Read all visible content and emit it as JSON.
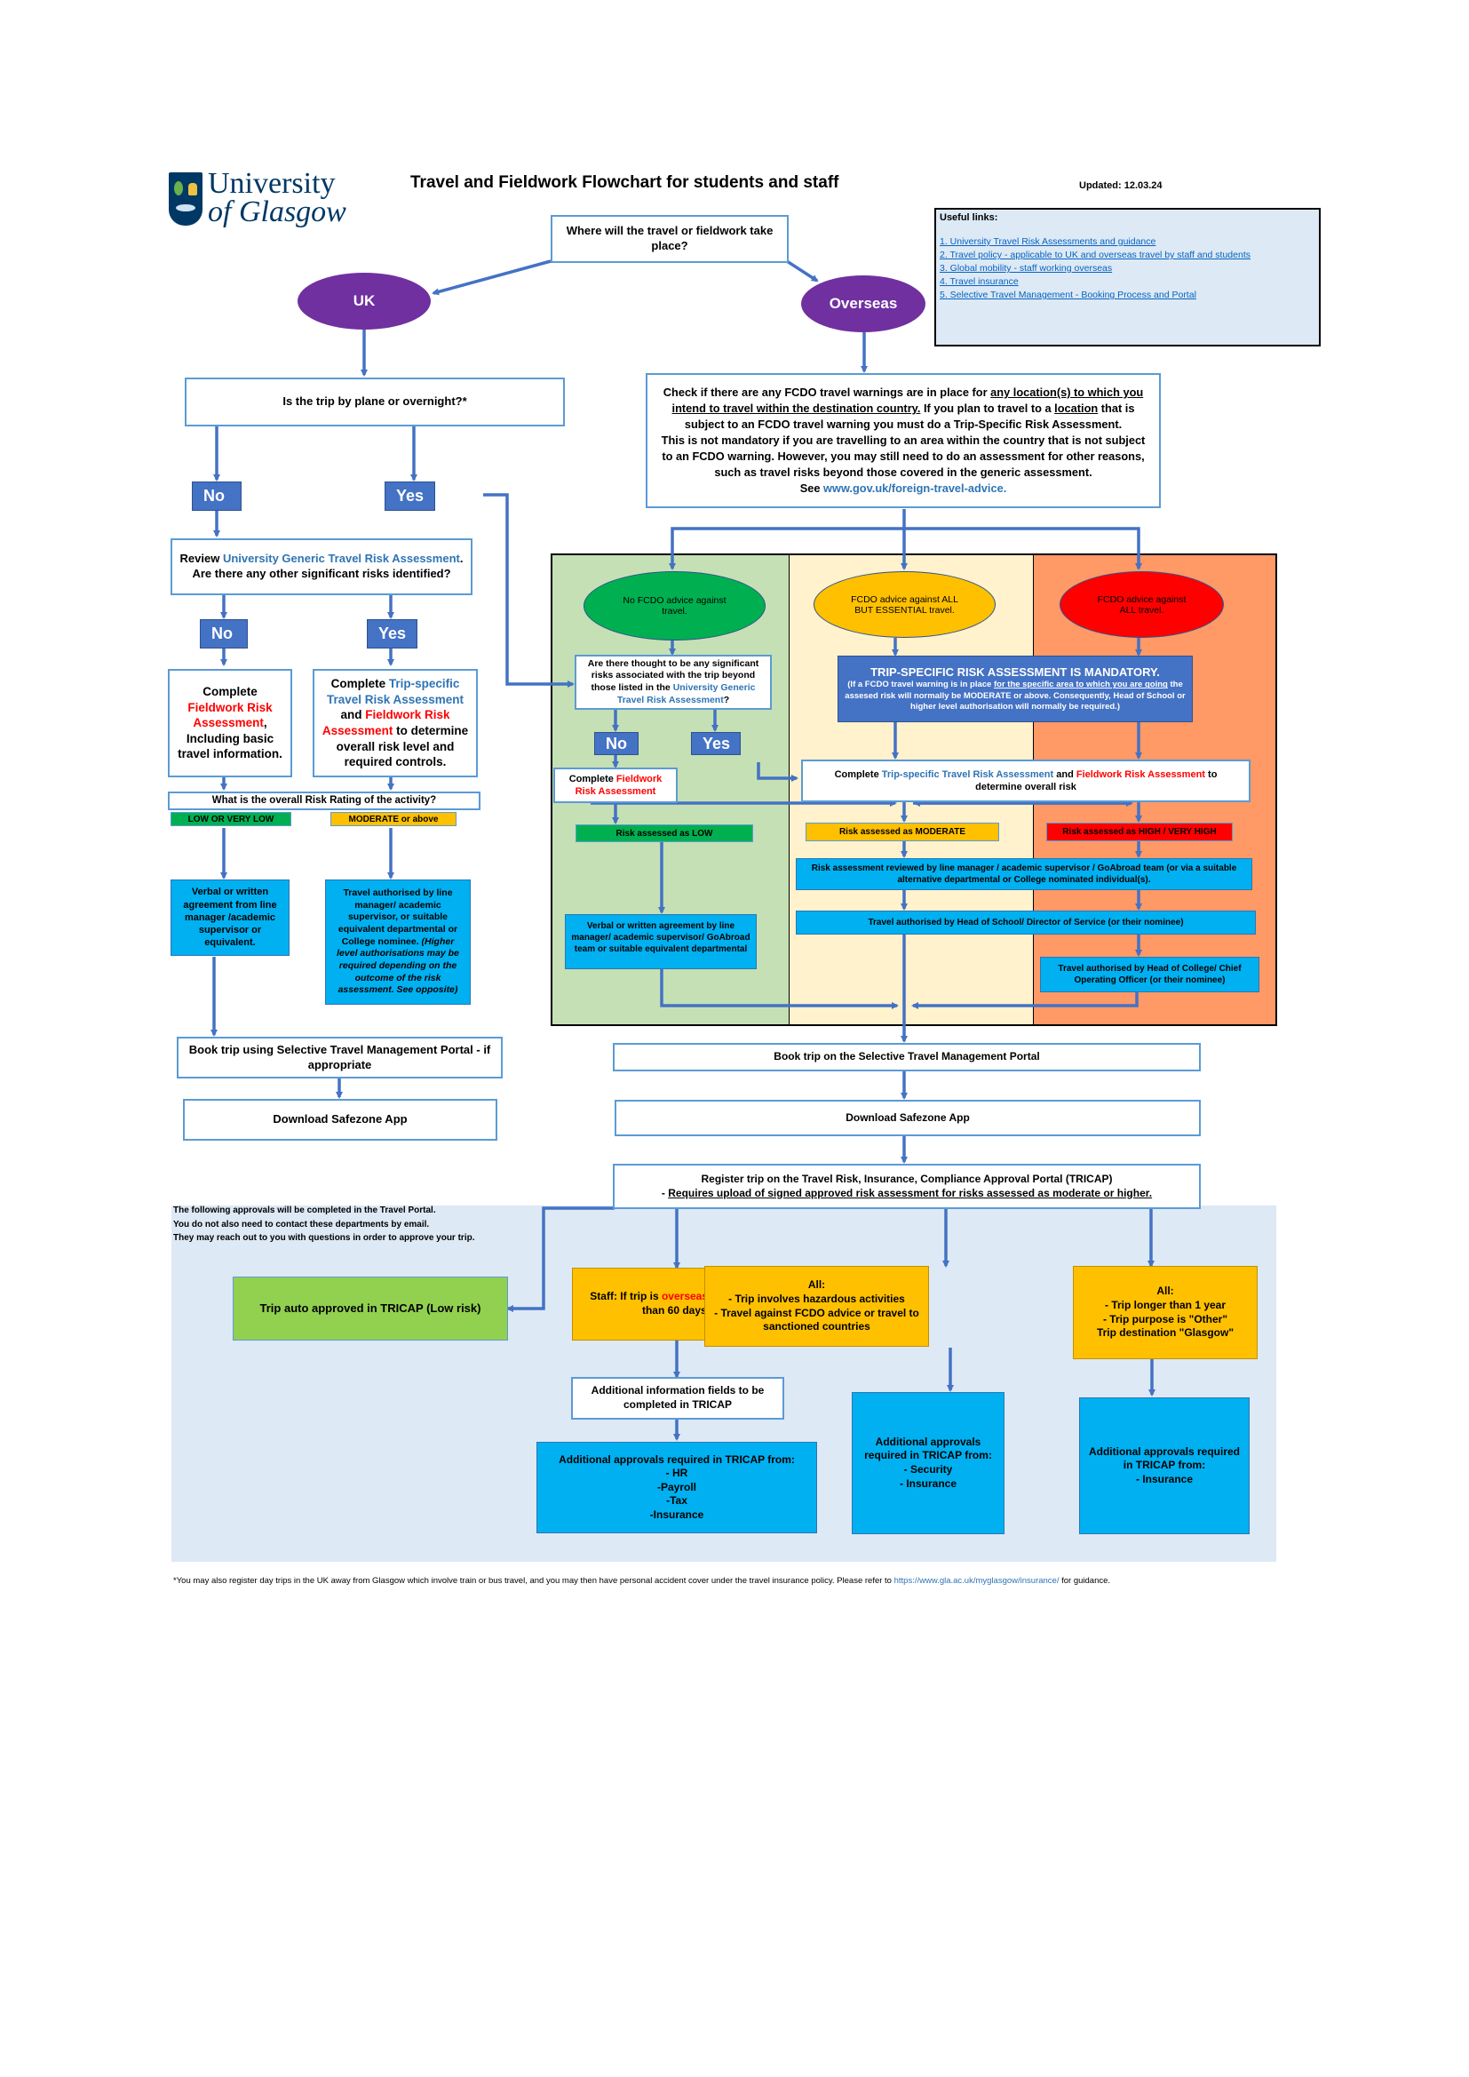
{
  "header": {
    "logo_line1": "University",
    "logo_line2": "of Glasgow",
    "title": "Travel and Fieldwork Flowchart for students and staff",
    "updated": "Updated: 12.03.24"
  },
  "useful_links": {
    "heading": "Useful links:",
    "items": [
      "1. University Travel Risk Assessments and guidance",
      "2. Travel policy - applicable to UK and overseas travel by staff and students",
      "3. Global mobility - staff working overseas",
      "4. Travel insurance",
      "5. Selective Travel Management - Booking Process and Portal"
    ]
  },
  "start": {
    "question": "Where will the travel or fieldwork take place?"
  },
  "branches": {
    "uk": "UK",
    "overseas": "Overseas"
  },
  "uk": {
    "q1": "Is the trip by plane or overnight?*",
    "no": "No",
    "yes": "Yes",
    "review_pre": "Review ",
    "review_link": "University Generic Travel Risk Assessment",
    "review_post": ". Are there any other significant risks identified?",
    "no2": "No",
    "yes2": "Yes",
    "complete_left_1": "Complete",
    "complete_left_red": "Fieldwork Risk Assessment",
    "complete_left_2": ", Including basic travel information.",
    "complete_right_1": "Complete ",
    "complete_right_blue": "Trip-specific Travel Risk Assessment",
    "complete_right_2": " and ",
    "complete_right_red": "Fieldwork Risk Assessment",
    "complete_right_3": " to determine overall risk level and required controls.",
    "risk_question": "What is the overall Risk Rating of the activity?",
    "low_label": "LOW OR VERY LOW",
    "mod_label": "MODERATE or above",
    "verbal": "Verbal or written agreement from line manager /academic supervisor or equivalent.",
    "authorised": "Travel authorised by line manager/ academic supervisor, or suitable equivalent departmental or College nominee.",
    "authorised_italic": "(Higher level authorisations may be required depending on the outcome of the risk assessment. See opposite)",
    "book": "Book trip using Selective Travel Management Portal - if appropriate",
    "download": "Download Safezone App"
  },
  "overseas": {
    "check_1": "Check if there are any FCDO travel warnings are in place for ",
    "check_u1": "any location(s) to which you intend to travel within the destination country.",
    "check_2": " If you plan to travel to a ",
    "check_u2": "location",
    "check_3": " that is subject to an FCDO travel warning you must do a Trip-Specific Risk Assessment.",
    "check_4": "This is not mandatory if you are travelling to an area within the country that is not subject to an FCDO warning.  However, you may still need to do an assessment for other reasons, such as travel risks beyond those covered in the generic assessment.",
    "check_see": "See ",
    "check_link": "www.gov.uk/foreign-travel-advice.",
    "oval_green": "No FCDO advice against travel.",
    "oval_amber": "FCDO advice against ALL BUT ESSENTIAL travel.",
    "oval_red": "FCDO advice against ALL travel.",
    "sig_q_1": "Are there thought to be any significant risks associated with the trip beyond those listed in the ",
    "sig_q_link": "University Generic Travel Risk Assessment",
    "sig_q_2": "?",
    "no": "No",
    "yes": "Yes",
    "complete_fw_1": "Complete ",
    "complete_fw_red": "Fieldwork Risk Assessment",
    "mandatory_title": "TRIP-SPECIFIC RISK ASSESSMENT IS MANDATORY.",
    "mandatory_1": "(If a FCDO travel warning is in place ",
    "mandatory_u": "for the specific area to which you are going",
    "mandatory_2": " the assesed risk will normally be MODERATE or above. Consequently, Head of School or higher level authorisation will normally be required.)",
    "complete_ts_1": "Complete ",
    "complete_ts_blue": "Trip-specific Travel Risk Assessment",
    "complete_ts_2": " and ",
    "complete_ts_red": "Fieldwork Risk Assessment",
    "complete_ts_3": " to determine overall risk",
    "risk_low": "Risk assessed as LOW",
    "risk_mod": "Risk assessed as MODERATE",
    "risk_high": "Risk assessed as HIGH / VERY HIGH",
    "reviewed": "Risk assessment reviewed by line manager / academic supervisor / GoAbroad team (or via a suitable alternative departmental or College nominated individual(s).",
    "verbal": "Verbal or written agreement by line manager/ academic supervisor/ GoAbroad team or suitable equivalent departmental",
    "auth_hos": "Travel authorised by Head of School/ Director of Service (or their nominee)",
    "auth_hoc": "Travel authorised by Head of College/ Chief Operating Officer (or their nominee)",
    "book": "Book trip on the Selective Travel Management Portal",
    "download": "Download Safezone App",
    "register_1": "Register trip on the Travel Risk, Insurance, Compliance Approval Portal (TRICAP)",
    "register_2_pre": "- ",
    "register_2_u": "Requires upload of signed approved risk assessment for risks assessed as moderate or higher."
  },
  "tricap": {
    "note": [
      "The following approvals will be completed in the Travel Portal.",
      "You do not also need to contact these departments by email.",
      "They may reach out to you with questions in order to approve your trip."
    ],
    "auto": "Trip auto approved in TRICAP (Low risk)",
    "staff_1": "Staff: If trip is ",
    "staff_red": "overseas",
    "staff_2": " and longer than 60 days?",
    "all_hazard": [
      "All:",
      "- Trip involves hazardous activities",
      "- Travel against FCDO advice or travel to sanctioned countries"
    ],
    "all_other": [
      "All:",
      "- Trip longer than 1 year",
      "- Trip purpose is \"Other\"",
      "Trip destination \"Glasgow\""
    ],
    "additional_info": "Additional information fields to be completed in TRICAP",
    "approvals_hr": [
      "Additional approvals required in TRICAP from:",
      "- HR",
      "-Payroll",
      "-Tax",
      "-Insurance"
    ],
    "approvals_sec": [
      "Additional approvals required in TRICAP from:",
      "- Security",
      "- Insurance"
    ],
    "approvals_ins": [
      "Additional approvals required in TRICAP from:",
      "- Insurance"
    ]
  },
  "footnote": {
    "text": "*You may also register day trips in the UK away from Glasgow which involve train or bus travel, and you may then have personal accident cover under the travel insurance policy.  Please refer to ",
    "link": "https://www.gla.ac.uk/myglasgow/insurance/",
    "post": " for guidance."
  },
  "colors": {
    "purple": "#7030a0",
    "box_border": "#5b9bd5",
    "arrow": "#4472c4",
    "lane_green": "#c5e0b4",
    "lane_amber": "#fff2cc",
    "lane_orange": "#ff9966",
    "status_green": "#00b050",
    "status_amber": "#ffc000",
    "status_red": "#ff0000",
    "cyan": "#00b0f0",
    "tricap_bg": "#dde9f5"
  }
}
